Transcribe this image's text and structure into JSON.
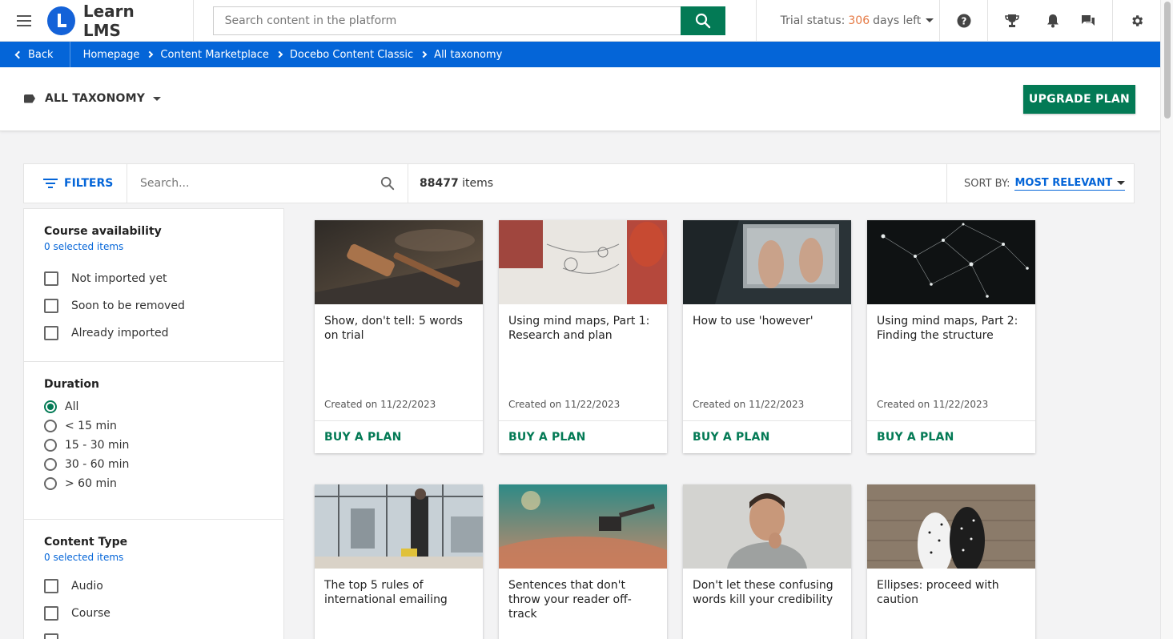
{
  "topbar": {
    "brand": "Learn LMS",
    "search_placeholder": "Search content in the platform",
    "trial_label": "Trial status:",
    "trial_days": "306",
    "trial_suffix": "days left"
  },
  "breadcrumb": {
    "back": "Back",
    "items": [
      "Homepage",
      "Content Marketplace",
      "Docebo Content Classic",
      "All taxonomy"
    ]
  },
  "header": {
    "taxonomy": "ALL TAXONOMY",
    "upgrade": "UPGRADE PLAN"
  },
  "toolbar": {
    "filters": "FILTERS",
    "search_placeholder": "Search...",
    "count": "88477",
    "count_suffix": "items",
    "sort_label": "SORT BY:",
    "sort_value": "MOST RELEVANT"
  },
  "filters": {
    "availability": {
      "title": "Course availability",
      "selected": "0 selected items",
      "options": [
        "Not imported yet",
        "Soon to be removed",
        "Already imported"
      ]
    },
    "duration": {
      "title": "Duration",
      "options": [
        "All",
        "< 15 min",
        "15 - 30 min",
        "30 - 60 min",
        "> 60 min"
      ],
      "selected_index": 0
    },
    "content_type": {
      "title": "Content Type",
      "selected": "0 selected items",
      "options": [
        "Audio",
        "Course"
      ]
    }
  },
  "cards": [
    {
      "title": "Show, don't tell: 5 words on trial",
      "date": "Created on 11/22/2023",
      "action": "BUY A PLAN"
    },
    {
      "title": "Using mind maps, Part 1: Research and plan",
      "date": "Created on 11/22/2023",
      "action": "BUY A PLAN"
    },
    {
      "title": "How to use 'however'",
      "date": "Created on 11/22/2023",
      "action": "BUY A PLAN"
    },
    {
      "title": "Using mind maps, Part 2: Finding the structure",
      "date": "Created on 11/22/2023",
      "action": "BUY A PLAN"
    },
    {
      "title": "The top 5 rules of international emailing"
    },
    {
      "title": "Sentences that don't throw your reader off-track"
    },
    {
      "title": "Don't let these confusing words kill your credibility"
    },
    {
      "title": "Ellipses: proceed with caution"
    }
  ],
  "colors": {
    "brand_green": "#037a55",
    "brand_blue": "#0465d8",
    "trial_orange": "#e57a45"
  }
}
